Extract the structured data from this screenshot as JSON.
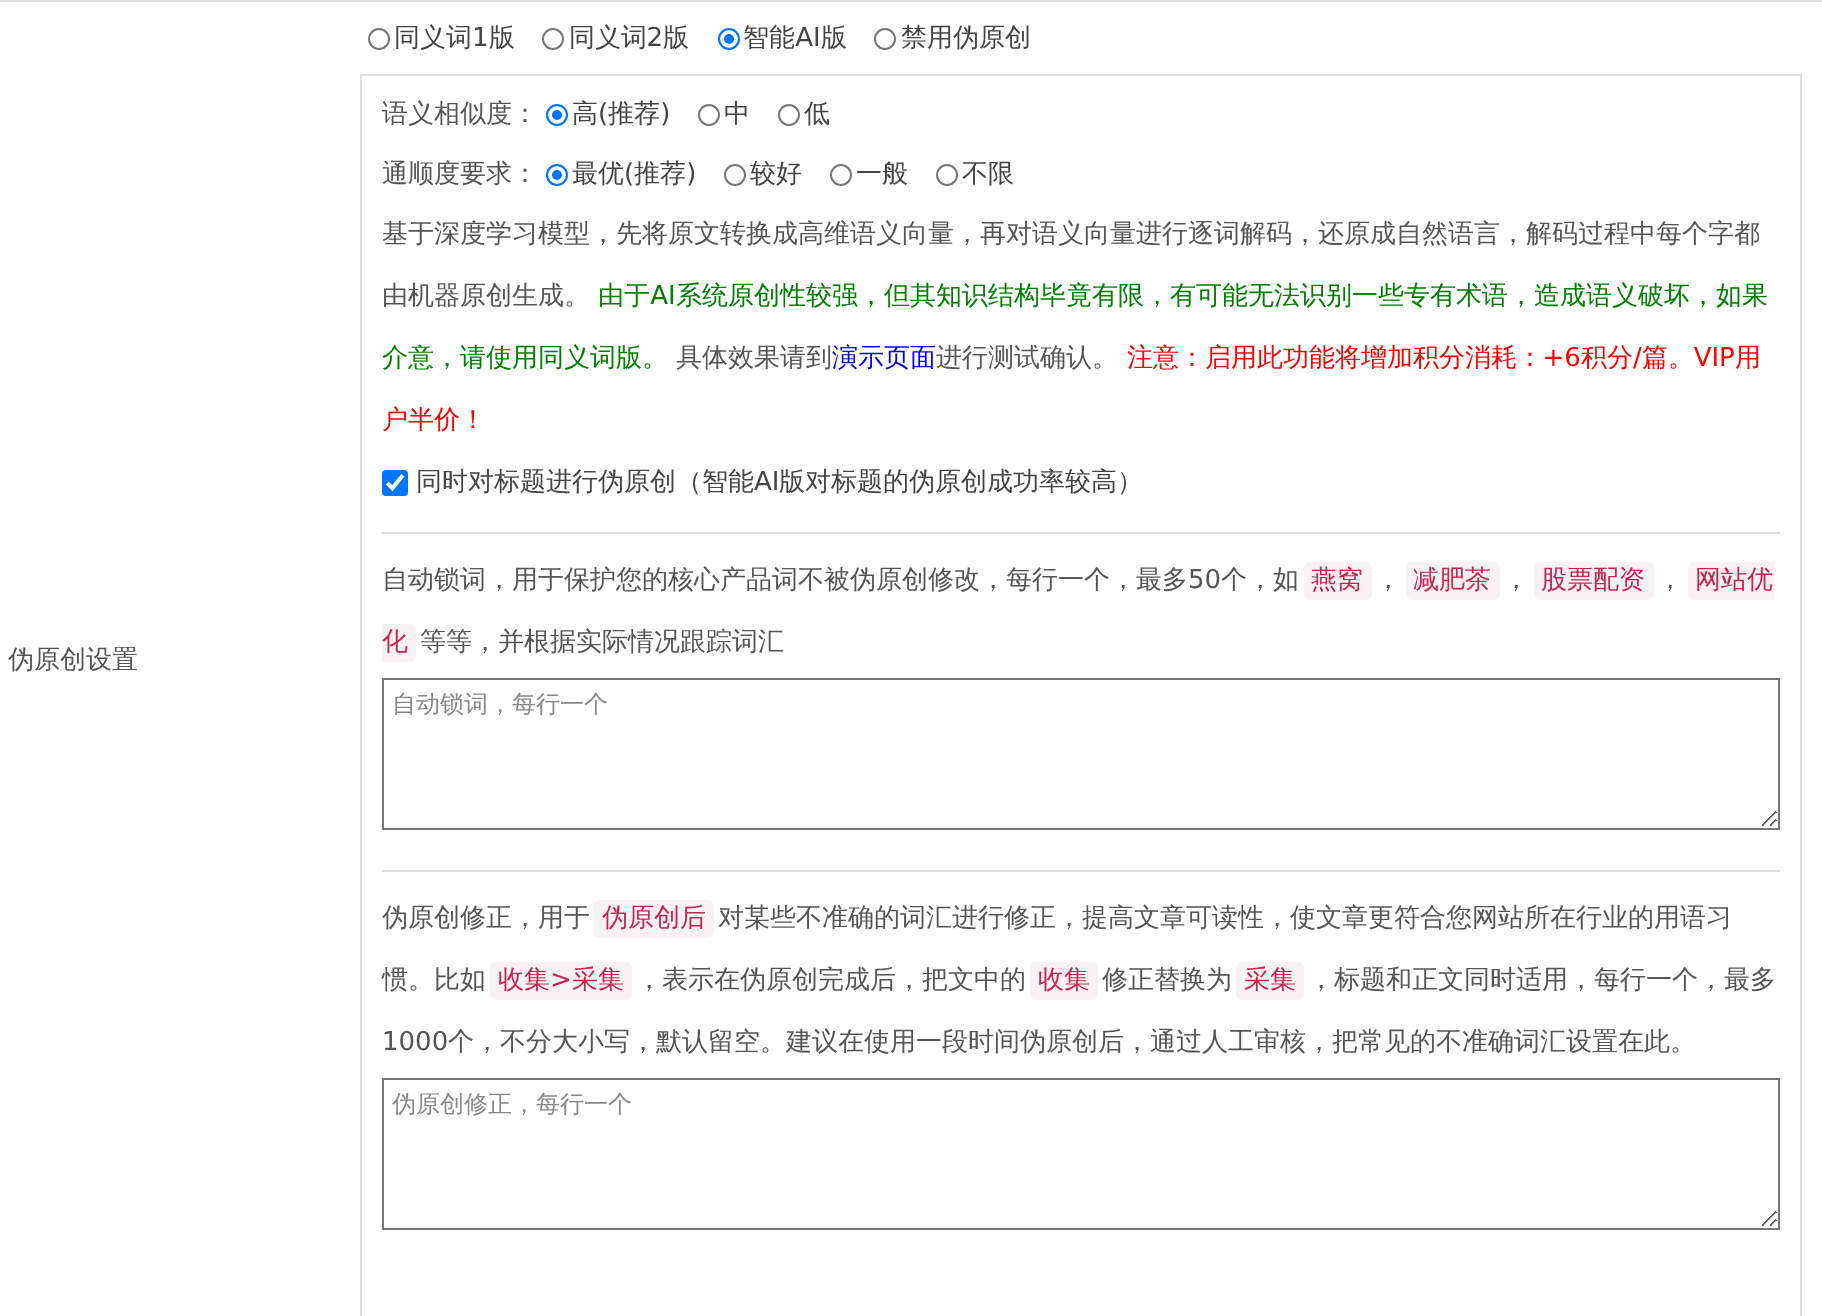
{
  "section_label": "伪原创设置",
  "modes": [
    {
      "label": "同义词1版",
      "selected": false
    },
    {
      "label": "同义词2版",
      "selected": false
    },
    {
      "label": "智能AI版",
      "selected": true
    },
    {
      "label": "禁用伪原创",
      "selected": false
    }
  ],
  "similarity": {
    "label": "语义相似度：",
    "options": [
      {
        "label": "高(推荐)",
        "selected": true
      },
      {
        "label": "中",
        "selected": false
      },
      {
        "label": "低",
        "selected": false
      }
    ]
  },
  "fluency": {
    "label": "通顺度要求：",
    "options": [
      {
        "label": "最优(推荐)",
        "selected": true
      },
      {
        "label": "较好",
        "selected": false
      },
      {
        "label": "一般",
        "selected": false
      },
      {
        "label": "不限",
        "selected": false
      }
    ]
  },
  "ai_description": [
    {
      "kind": "plain",
      "text": "基于深度学习模型，先将原文转换成高维语义向量，再对语义向量进行逐词解码，还原成自然语言，解码过程中每个字都由机器原创生成。 "
    },
    {
      "kind": "notice",
      "text": "由于AI系统原创性较强，但其知识结构毕竟有限，有可能无法识别一些专有术语，造成语义破坏，如果介意，请使用同义词版。"
    },
    {
      "kind": "plain",
      "text": " 具体效果请到"
    },
    {
      "kind": "link",
      "text": "演示页面"
    },
    {
      "kind": "plain",
      "text": "进行测试确认。 "
    },
    {
      "kind": "warning",
      "text": "注意：启用此功能将增加积分消耗：+6积分/篇。VIP用户半价！"
    }
  ],
  "title_option": {
    "label": "同时对标题进行伪原创（智能AI版对标题的伪原创成功率较高）",
    "checked": true
  },
  "lock_words": {
    "description": [
      {
        "kind": "text",
        "text": "自动锁词，用于保护您的核心产品词不被伪原创修改，每行一个，最多50个，如"
      },
      {
        "kind": "tag",
        "text": "燕窝"
      },
      {
        "kind": "text",
        "text": "，"
      },
      {
        "kind": "tag",
        "text": "减肥茶"
      },
      {
        "kind": "text",
        "text": "，"
      },
      {
        "kind": "tag",
        "text": "股票配资"
      },
      {
        "kind": "text",
        "text": "，"
      },
      {
        "kind": "tag",
        "text": "网站优化"
      },
      {
        "kind": "text",
        "text": "等等，并根据实际情况跟踪词汇"
      }
    ],
    "placeholder": "自动锁词，每行一个"
  },
  "correction": {
    "description": [
      {
        "kind": "text",
        "text": "伪原创修正，用于"
      },
      {
        "kind": "tag",
        "text": "伪原创后"
      },
      {
        "kind": "text",
        "text": "对某些不准确的词汇进行修正，提高文章可读性，使文章更符合您网站所在行业的用语习惯。比如"
      },
      {
        "kind": "tag",
        "text": "收集>采集"
      },
      {
        "kind": "text",
        "text": "，表示在伪原创完成后，把文中的"
      },
      {
        "kind": "tag",
        "text": "收集"
      },
      {
        "kind": "text",
        "text": "修正替换为"
      },
      {
        "kind": "tag",
        "text": "采集"
      },
      {
        "kind": "text",
        "text": "，标题和正文同时适用，每行一个，最多1000个，不分大小写，默认留空。建议在使用一段时间伪原创后，通过人工审核，把常见的不准确词汇设置在此。"
      }
    ],
    "placeholder": "伪原创修正，每行一个"
  }
}
